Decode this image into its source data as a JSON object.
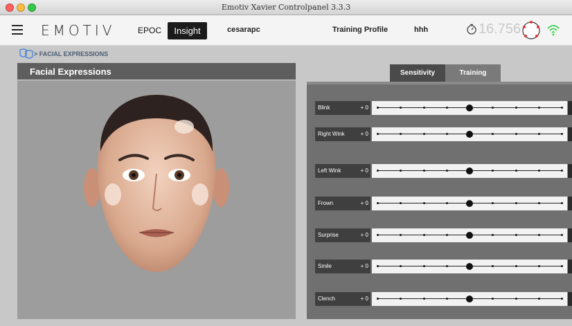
{
  "window": {
    "title": "Emotiv Xavier Controlpanel 3.3.3"
  },
  "nav": {
    "brand": "EMOTIV",
    "epoc": "EPOC",
    "insight": "Insight",
    "user": "cesarapc",
    "training_profile_label": "Training Profile",
    "training_profile_value": "hhh",
    "timer_value": "16.756",
    "icons": [
      "menu-icon",
      "timer-icon",
      "contact-quality-icon",
      "wifi-icon"
    ]
  },
  "breadcrumb": {
    "icon": "facial-expressions-icon",
    "text": "> FACIAL EXPRESSIONS"
  },
  "left_panel": {
    "title": "Facial Expressions"
  },
  "tabs": [
    {
      "label": "Sensitivity",
      "active": true
    },
    {
      "label": "Training",
      "active": false
    }
  ],
  "expressions": [
    {
      "label": "Blink",
      "value": "+ 0",
      "level": 0.5
    },
    {
      "label": "Right Wink",
      "value": "+ 0",
      "level": 0.5
    },
    {
      "label": "Left Wink",
      "value": "+ 0",
      "level": 0.5
    },
    {
      "label": "Frown",
      "value": "+ 0",
      "level": 0.5
    },
    {
      "label": "Surprise",
      "value": "+ 0",
      "level": 0.5
    },
    {
      "label": "Smile",
      "value": "+ 0",
      "level": 0.5
    },
    {
      "label": "Clench",
      "value": "+ 0",
      "level": 0.5
    }
  ],
  "colors": {
    "accent_active_tab": "#4a4a4a",
    "insight_button": "#1b1b1b",
    "wifi": "#2ecc40",
    "slider_end": "#6fbf3a"
  }
}
